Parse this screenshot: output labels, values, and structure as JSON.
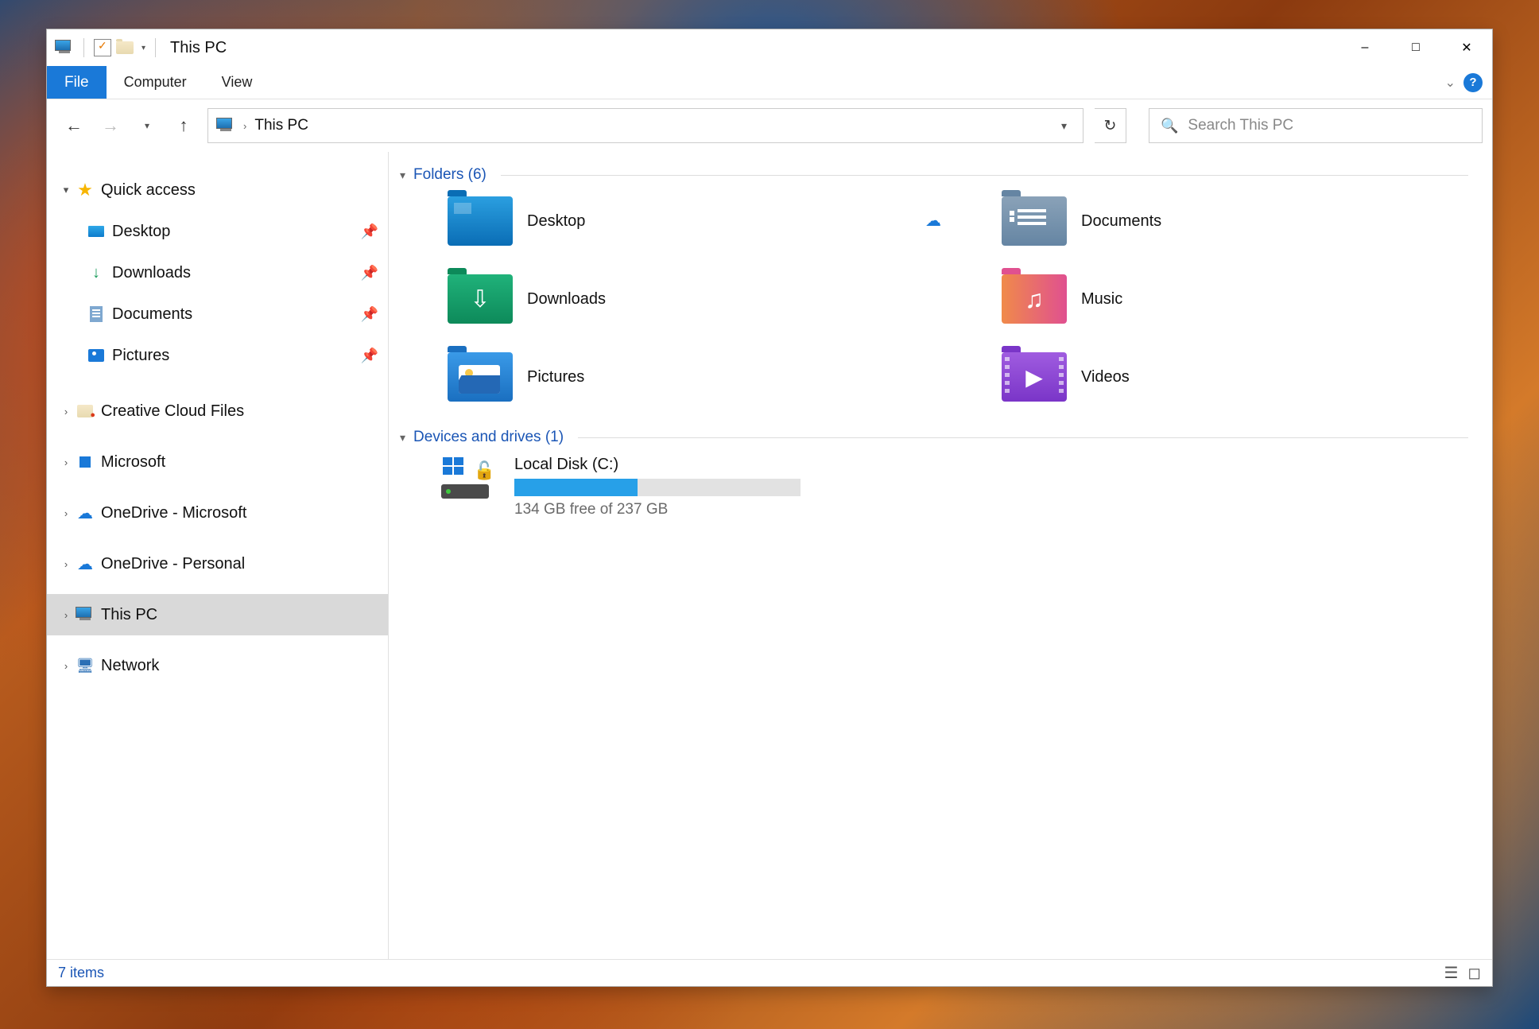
{
  "window": {
    "title": "This PC"
  },
  "ribbon": {
    "file": "File",
    "tabs": [
      "Computer",
      "View"
    ]
  },
  "nav": {
    "breadcrumb": [
      "This PC"
    ],
    "search_placeholder": "Search This PC"
  },
  "sidebar": {
    "quick_access": {
      "label": "Quick access",
      "items": [
        {
          "label": "Desktop",
          "pinned": true
        },
        {
          "label": "Downloads",
          "pinned": true
        },
        {
          "label": "Documents",
          "pinned": true
        },
        {
          "label": "Pictures",
          "pinned": true
        }
      ]
    },
    "nodes": [
      {
        "label": "Creative Cloud Files"
      },
      {
        "label": "Microsoft"
      },
      {
        "label": "OneDrive - Microsoft"
      },
      {
        "label": "OneDrive - Personal"
      },
      {
        "label": "This PC",
        "selected": true
      },
      {
        "label": "Network"
      }
    ]
  },
  "sections": {
    "folders": {
      "label": "Folders (6)",
      "items": [
        {
          "label": "Desktop",
          "kind": "desktop",
          "cloud": true
        },
        {
          "label": "Documents",
          "kind": "documents",
          "cloud": true
        },
        {
          "label": "Downloads",
          "kind": "downloads",
          "cloud": false
        },
        {
          "label": "Music",
          "kind": "music",
          "cloud": false
        },
        {
          "label": "Pictures",
          "kind": "pictures",
          "cloud": true
        },
        {
          "label": "Videos",
          "kind": "videos",
          "cloud": false
        }
      ]
    },
    "drives": {
      "label": "Devices and drives (1)",
      "items": [
        {
          "label": "Local Disk (C:)",
          "free_text": "134 GB free of 237 GB",
          "used_pct": 43
        }
      ]
    }
  },
  "status": {
    "text": "7 items"
  }
}
